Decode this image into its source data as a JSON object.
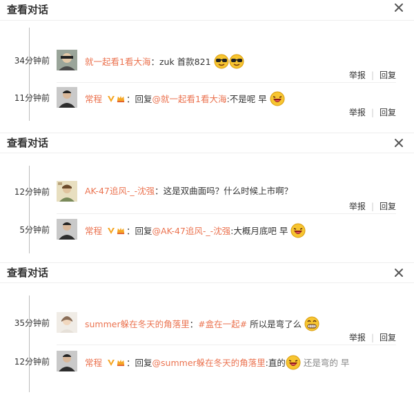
{
  "panels": [
    {
      "title": "查看对话",
      "entries": [
        {
          "time": "34分钟前",
          "user": "就一起看1看大海",
          "separator": "：",
          "text": "zuk 首款821",
          "emojis": [
            "sunglasses-emoji",
            "sunglasses-emoji"
          ],
          "report": "举报",
          "reply": "回复"
        },
        {
          "time": "11分钟前",
          "user": "常程",
          "separator": "：",
          "reply_prefix": "回复",
          "mention": "@就一起看1看大海",
          "text": ":不是呢 早",
          "emojis": [
            "laugh-emoji"
          ],
          "report": "举报",
          "reply": "回复"
        }
      ]
    },
    {
      "title": "查看对话",
      "entries": [
        {
          "time": "12分钟前",
          "user": "AK-47追风-_-沈强",
          "separator": "：",
          "text": "这是双曲面吗？什么时候上市啊？",
          "emojis": [],
          "report": "举报",
          "reply": "回复"
        },
        {
          "time": "5分钟前",
          "user": "常程",
          "separator": "：",
          "reply_prefix": "回复",
          "mention": "@AK-47追风-_-沈强",
          "text": ":大概月底吧 早",
          "emojis": [
            "laugh-emoji"
          ]
        }
      ]
    },
    {
      "title": "查看对话",
      "entries": [
        {
          "time": "35分钟前",
          "user": "summer躲在冬天的角落里",
          "separator": "：",
          "mention": "#盒在一起#",
          "text": " 所以是弯了么",
          "emojis": [
            "grin-emoji"
          ],
          "report": "举报",
          "reply": "回复"
        },
        {
          "time": "12分钟前",
          "user": "常程",
          "separator": "：",
          "reply_prefix": "回复",
          "mention": "@summer躲在冬天的角落里",
          "text": ":直的",
          "emojis": [
            "laugh-emoji"
          ],
          "text_after": " 还是弯的 早"
        }
      ]
    }
  ],
  "colors": {
    "accent": "#eb7350",
    "text": "#333333",
    "divider": "#eeeeee",
    "timeline": "#bbbbbb",
    "verified": "#f5a623"
  }
}
